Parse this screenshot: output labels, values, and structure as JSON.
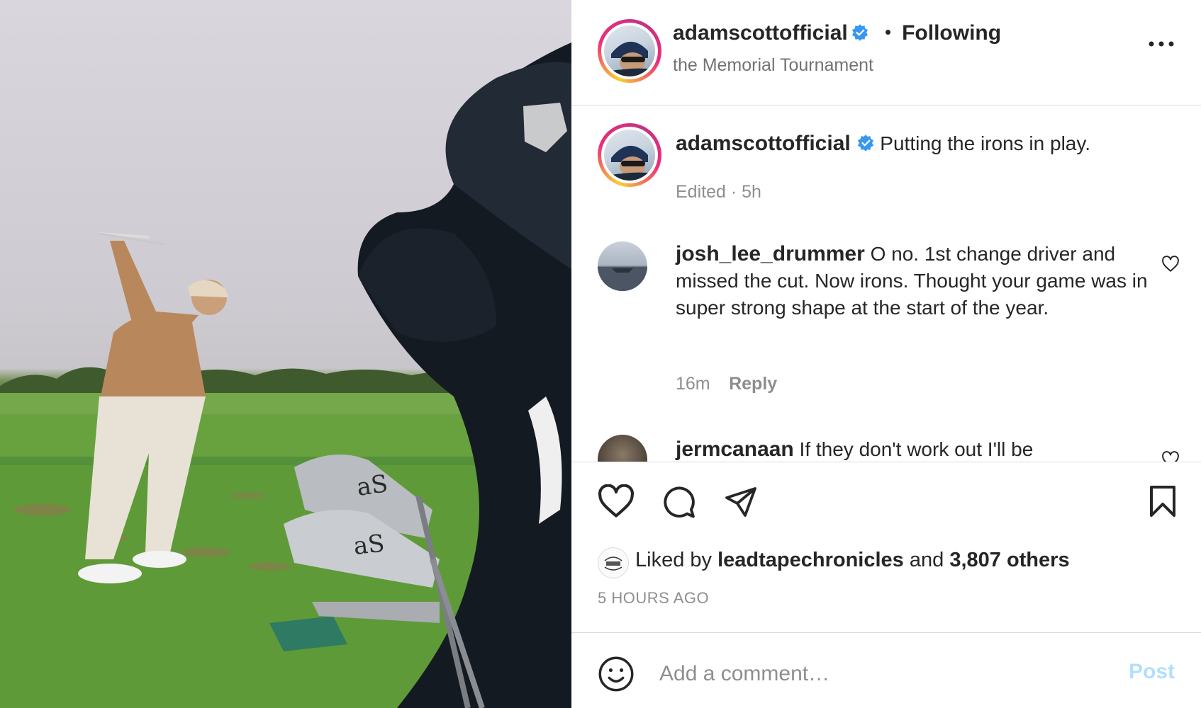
{
  "post": {
    "username": "adamscottofficial",
    "follow_status": "Following",
    "location": "the Memorial Tournament",
    "caption": "Putting the irons in play.",
    "caption_meta": "Edited · 5h"
  },
  "comments": [
    {
      "username": "josh_lee_drummer",
      "text": "O no. 1st change driver and missed the cut. Now irons. Thought your game was in super strong shape at the start of the year.",
      "time": "16m",
      "reply_label": "Reply"
    },
    {
      "username": "jermcanaan",
      "text": "If they don't work out I'll be"
    }
  ],
  "likes": {
    "prefix": "Liked by",
    "user": "leadtapechronicles",
    "joiner": "and",
    "others": "3,807 others"
  },
  "time_ago": "5 HOURS AGO",
  "comment_box": {
    "placeholder": "Add a comment…",
    "post_label": "Post"
  },
  "icons": {
    "verified": "verified-badge-icon",
    "more": "more-options-icon",
    "like": "heart-icon",
    "comment": "comment-icon",
    "share": "paper-plane-icon",
    "save": "bookmark-icon",
    "emoji": "emoji-icon"
  },
  "colors": {
    "verified_blue": "#3897f0",
    "post_button_disabled": "#b2dffc",
    "text_primary": "#262626",
    "text_secondary": "#8e8e8e"
  }
}
